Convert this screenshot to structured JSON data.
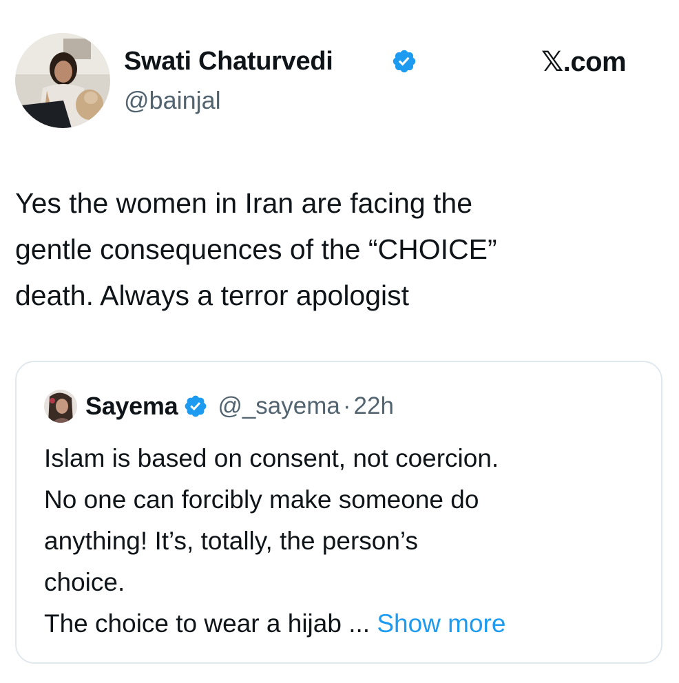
{
  "author": {
    "name": "Swati Chaturvedi",
    "handle": "@bainjal",
    "verified_icon": "verified-badge",
    "avatar_icon": "profile-photo"
  },
  "source": {
    "label": "𝕏.com"
  },
  "tweet": {
    "text": "Yes the women in Iran are facing the\ngentle consequences of the “CHOICE”\ndeath. Always a terror apologist"
  },
  "quoted_tweet": {
    "name": "Sayema",
    "handle": "@_sayema",
    "separator": "·",
    "time": "22h",
    "verified_icon": "verified-badge",
    "avatar_icon": "profile-photo",
    "lines": [
      "Islam is based on consent, not coercion.",
      "No one can forcibly make someone do",
      "anything! It’s, totally, the person’s",
      "choice.",
      "The choice to wear a hijab ... "
    ],
    "show_more": "Show more"
  },
  "colors": {
    "verified": "#1d9bf0",
    "link": "#1d9bf0",
    "secondary_text": "#536471",
    "border": "#e1e8ed"
  }
}
